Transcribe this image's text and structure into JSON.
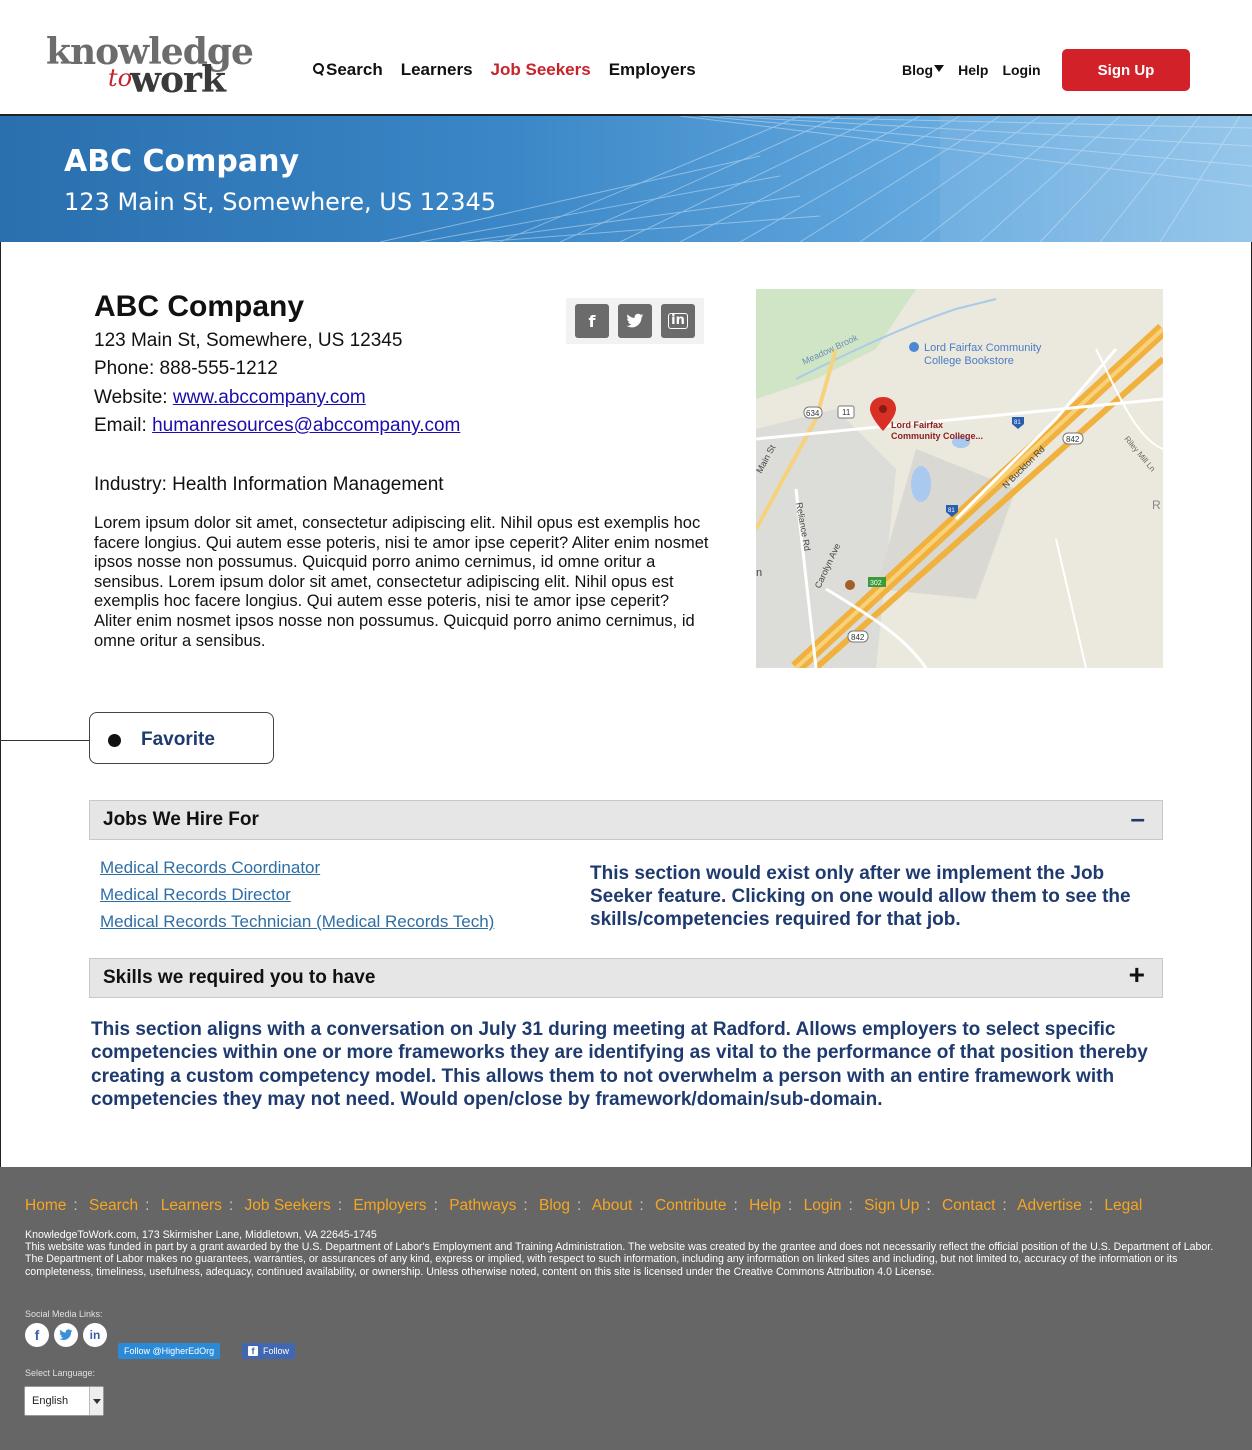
{
  "header": {
    "logo": {
      "top": "knowledge",
      "to": "to",
      "work": "work"
    },
    "nav": {
      "search": "Search",
      "learners": "Learners",
      "job_seekers": "Job Seekers",
      "employers": "Employers"
    },
    "right": {
      "blog": "Blog",
      "help": "Help",
      "login": "Login",
      "signup": "Sign Up"
    }
  },
  "banner": {
    "title": "ABC Company",
    "address": "123 Main St, Somewhere, US 12345"
  },
  "company": {
    "name": "ABC Company",
    "address": "123 Main St, Somewhere, US 12345",
    "phone": "Phone: 888-555-1212",
    "website_label": "Website: ",
    "website": "www.abccompany.com",
    "email_label": "Email: ",
    "email": "humanresources@abccompany.com",
    "industry": "Industry: Health Information Management",
    "description": "Lorem ipsum dolor sit amet, consectetur adipiscing elit. Nihil opus est exemplis hoc facere longius. Qui autem esse poteris, nisi te amor ipse ceperit? Aliter enim nosmet ipsos nosse non possumus. Quicquid porro animo cernimus, id omne oritur a sensibus. Lorem ipsum dolor sit amet, consectetur adipiscing elit. Nihil opus est exemplis hoc facere longius. Qui autem esse poteris, nisi te amor ipse ceperit? Aliter enim nosmet ipsos nosse non possumus. Quicquid porro animo cernimus, id omne oritur a sensibus."
  },
  "social": {
    "facebook": "f",
    "twitter": "t",
    "linkedin": "in"
  },
  "map": {
    "place1": "Lord Fairfax Community",
    "place1b": "College Bookstore",
    "place2": "Lord Fairfax",
    "place2b": "Community College...",
    "road_meadow": "Meadow Brook",
    "road_main": "Main St",
    "road_reliance": "Reliance Rd",
    "road_buckton": "N Buckton Rd",
    "road_carolyn": "Carolyn Ave",
    "road_riley": "Riley Mill Ln",
    "shield_634": "634",
    "shield_11": "11",
    "shield_81a": "81",
    "shield_81b": "81",
    "shield_842a": "842",
    "shield_842b": "842",
    "shield_302": "302",
    "letter_r": "R",
    "letter_n": "n"
  },
  "favorite": {
    "label": "Favorite"
  },
  "jobs_section": {
    "title": "Jobs We Hire For",
    "toggle": "–",
    "jobs": [
      "Medical Records Coordinator",
      "Medical Records Director",
      "Medical Records Technician (Medical Records Tech)"
    ],
    "note": "This section would exist only after we implement the Job Seeker feature. Clicking on one would allow them to see the skills/competencies required for that job."
  },
  "skills_section": {
    "title": "Skills we required you to have",
    "toggle": "+",
    "note": "This section aligns with a conversation on July 31 during meeting at Radford. Allows employers to select specific competencies within one or more frameworks they are identifying as vital to the performance of that position thereby creating a custom competency model. This allows them to not overwhelm a person with an entire framework with competencies they may not need. Would open/close by framework/domain/sub-domain."
  },
  "footer": {
    "links": [
      "Home",
      "Search",
      "Learners",
      "Job Seekers",
      "Employers",
      "Pathways",
      "Blog",
      "About",
      "Contribute",
      "Help",
      "Login",
      "Sign Up",
      "Contact",
      "Advertise",
      "Legal"
    ],
    "address": "KnowledgeToWork.com, 173 Skirmisher Lane, Middletown, VA 22645-1745",
    "disclaimer": "This website was funded in part by a grant awarded by the U.S. Department of Labor's Employment and Training Administration. The website was created by the grantee and does not necessarily reflect the official position of the U.S. Department of Labor. The Department of Labor makes no guarantees, warranties, or assurances of any kind, express or implied, with respect to such information, including any information on linked sites and including, but not limited to, accuracy of the information or its completeness, timeliness, usefulness, adequacy, continued availability, or ownership. Unless otherwise noted, content on this site is licensed under the Creative Commons Attribution 4.0 License.",
    "social_label": "Social Media Links:",
    "twitter_follow": "Follow @HigherEdOrg",
    "fb_follow": "Follow",
    "language_label": "Select Language:",
    "language": "English"
  },
  "colors": {
    "brand_red": "#d22128",
    "accent_blue": "#1e3a6e",
    "link_blue": "#2e6ea6",
    "footer_bg": "#666666",
    "footer_link": "#f5a623"
  }
}
